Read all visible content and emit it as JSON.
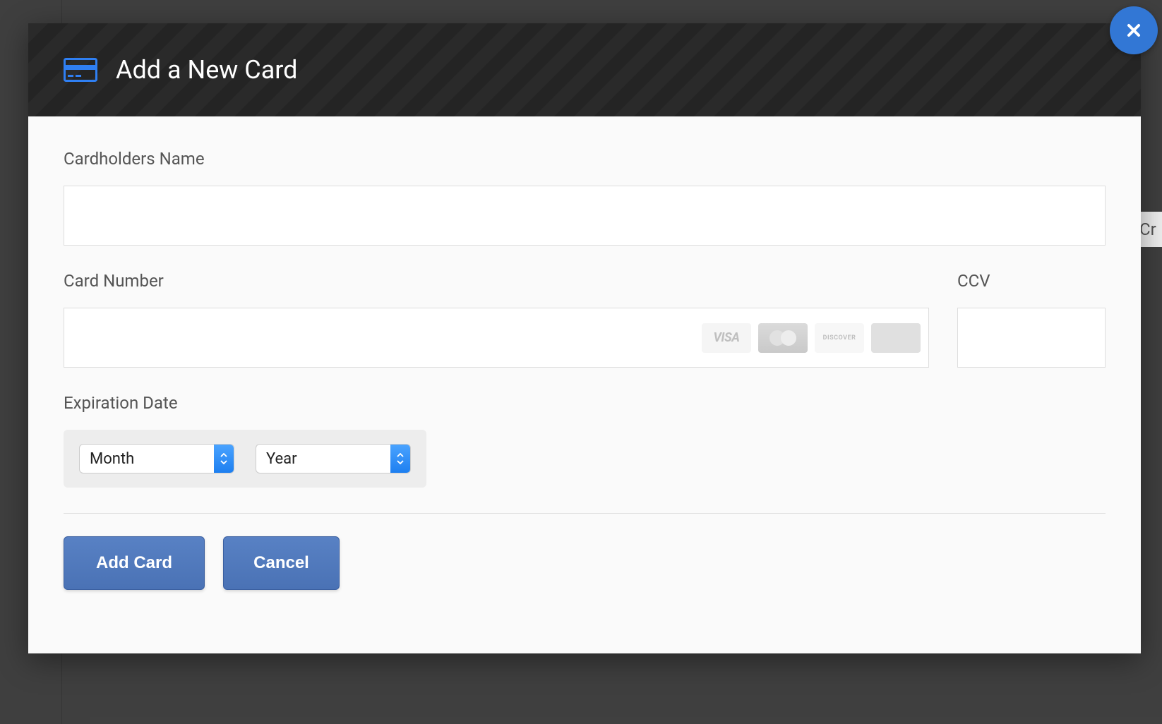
{
  "modal": {
    "title": "Add a New Card",
    "labels": {
      "cardholder_name": "Cardholders Name",
      "card_number": "Card Number",
      "ccv": "CCV",
      "expiration": "Expiration Date"
    },
    "values": {
      "cardholder_name": "",
      "card_number": "",
      "ccv": ""
    },
    "card_brands": {
      "visa": "VISA",
      "mastercard": "",
      "discover": "DISCOVER",
      "amex": ""
    },
    "expiration": {
      "month_selected": "Month",
      "year_selected": "Year"
    },
    "buttons": {
      "add": "Add Card",
      "cancel": "Cancel"
    }
  },
  "background": {
    "partial_text": "Cr"
  }
}
